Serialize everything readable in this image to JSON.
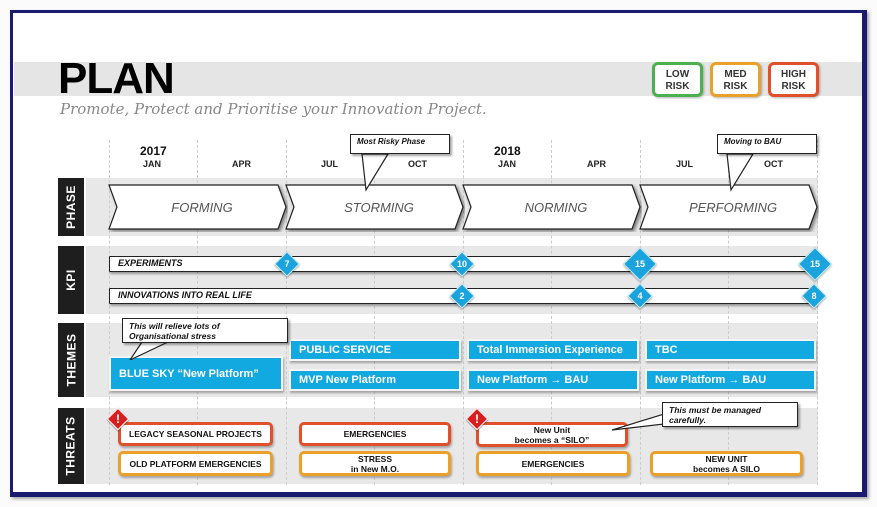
{
  "header": {
    "title": "PLAN",
    "subtitle": "Promote, Protect and Prioritise your Innovation Project."
  },
  "risk_legend": [
    {
      "line1": "LOW",
      "line2": "RISK",
      "color": "#4caf50"
    },
    {
      "line1": "MED",
      "line2": "RISK",
      "color": "#eba02a"
    },
    {
      "line1": "HIGH",
      "line2": "RISK",
      "color": "#e0502a"
    }
  ],
  "timeline": {
    "years": [
      "2017",
      "2018"
    ],
    "months": [
      "JAN",
      "APR",
      "JUL",
      "OCT",
      "JAN",
      "APR",
      "JUL",
      "OCT"
    ]
  },
  "rows": {
    "phase": "PHASE",
    "kpi": "KPI",
    "themes": "THEMES",
    "threats": "THREATS"
  },
  "phases": [
    "FORMING",
    "STORMING",
    "NORMING",
    "PERFORMING"
  ],
  "callouts": {
    "most_risky": "Most Risky Phase",
    "moving_bau": "Moving to BAU",
    "relieve_line1": "This will relieve lots of",
    "relieve_line2": "Organisational stress",
    "managed_line1": "This must be managed",
    "managed_line2": "carefully."
  },
  "kpis": [
    {
      "label": "EXPERIMENTS",
      "milestones": [
        "7",
        "10",
        "15",
        "15"
      ]
    },
    {
      "label": "INNOVATIONS INTO REAL LIFE",
      "milestones": [
        "2",
        "4",
        "8"
      ]
    }
  ],
  "themes": {
    "blue_sky": "BLUE SKY “New Platform”",
    "public_service": "PUBLIC SERVICE",
    "mvp": "MVP New Platform",
    "total_immersion": "Total Immersion Experience",
    "new_platform_bau_1": "New Platform → BAU",
    "tbc": "TBC",
    "new_platform_bau_2": "New Platform → BAU"
  },
  "threats": {
    "legacy": "LEGACY SEASONAL PROJECTS",
    "old_platform": "OLD PLATFORM EMERGENCIES",
    "emergencies_1": "EMERGENCIES",
    "stress_line1": "STRESS",
    "stress_line2": "in New M.O.",
    "silo_line1": "New Unit",
    "silo_line2": "becomes a “SILO”",
    "emergencies_2": "EMERGENCIES",
    "new_unit_line1": "NEW UNIT",
    "new_unit_line2": "becomes A SILO"
  },
  "icons": {
    "warning": "!"
  }
}
